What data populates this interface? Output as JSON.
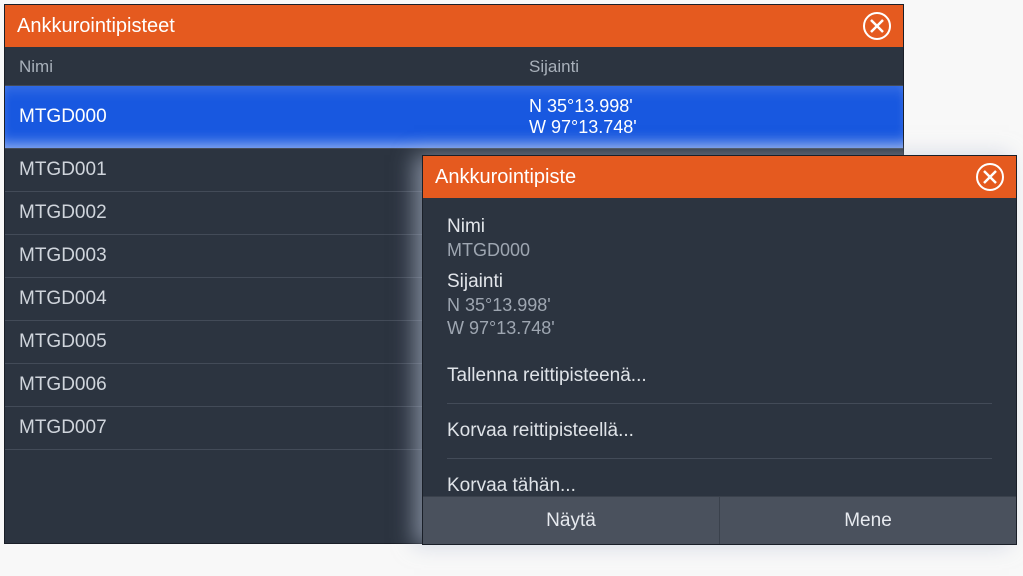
{
  "listWindow": {
    "title": "Ankkurointipisteet",
    "headers": {
      "name": "Nimi",
      "location": "Sijainti"
    },
    "rows": [
      {
        "name": "MTGD000",
        "lat": "N  35°13.998'",
        "lon": "W  97°13.748'",
        "selected": true
      },
      {
        "name": "MTGD001"
      },
      {
        "name": "MTGD002"
      },
      {
        "name": "MTGD003"
      },
      {
        "name": "MTGD004"
      },
      {
        "name": "MTGD005"
      },
      {
        "name": "MTGD006"
      },
      {
        "name": "MTGD007"
      }
    ]
  },
  "detailWindow": {
    "title": "Ankkurointipiste",
    "labels": {
      "name": "Nimi",
      "location": "Sijainti"
    },
    "values": {
      "name": "MTGD000",
      "lat": "N  35°13.998'",
      "lon": "W  97°13.748'"
    },
    "menu": {
      "saveAs": "Tallenna reittipisteenä...",
      "replaceWith": "Korvaa reittipisteellä...",
      "replaceHere": "Korvaa tähän..."
    },
    "buttons": {
      "show": "Näytä",
      "go": "Mene"
    }
  }
}
